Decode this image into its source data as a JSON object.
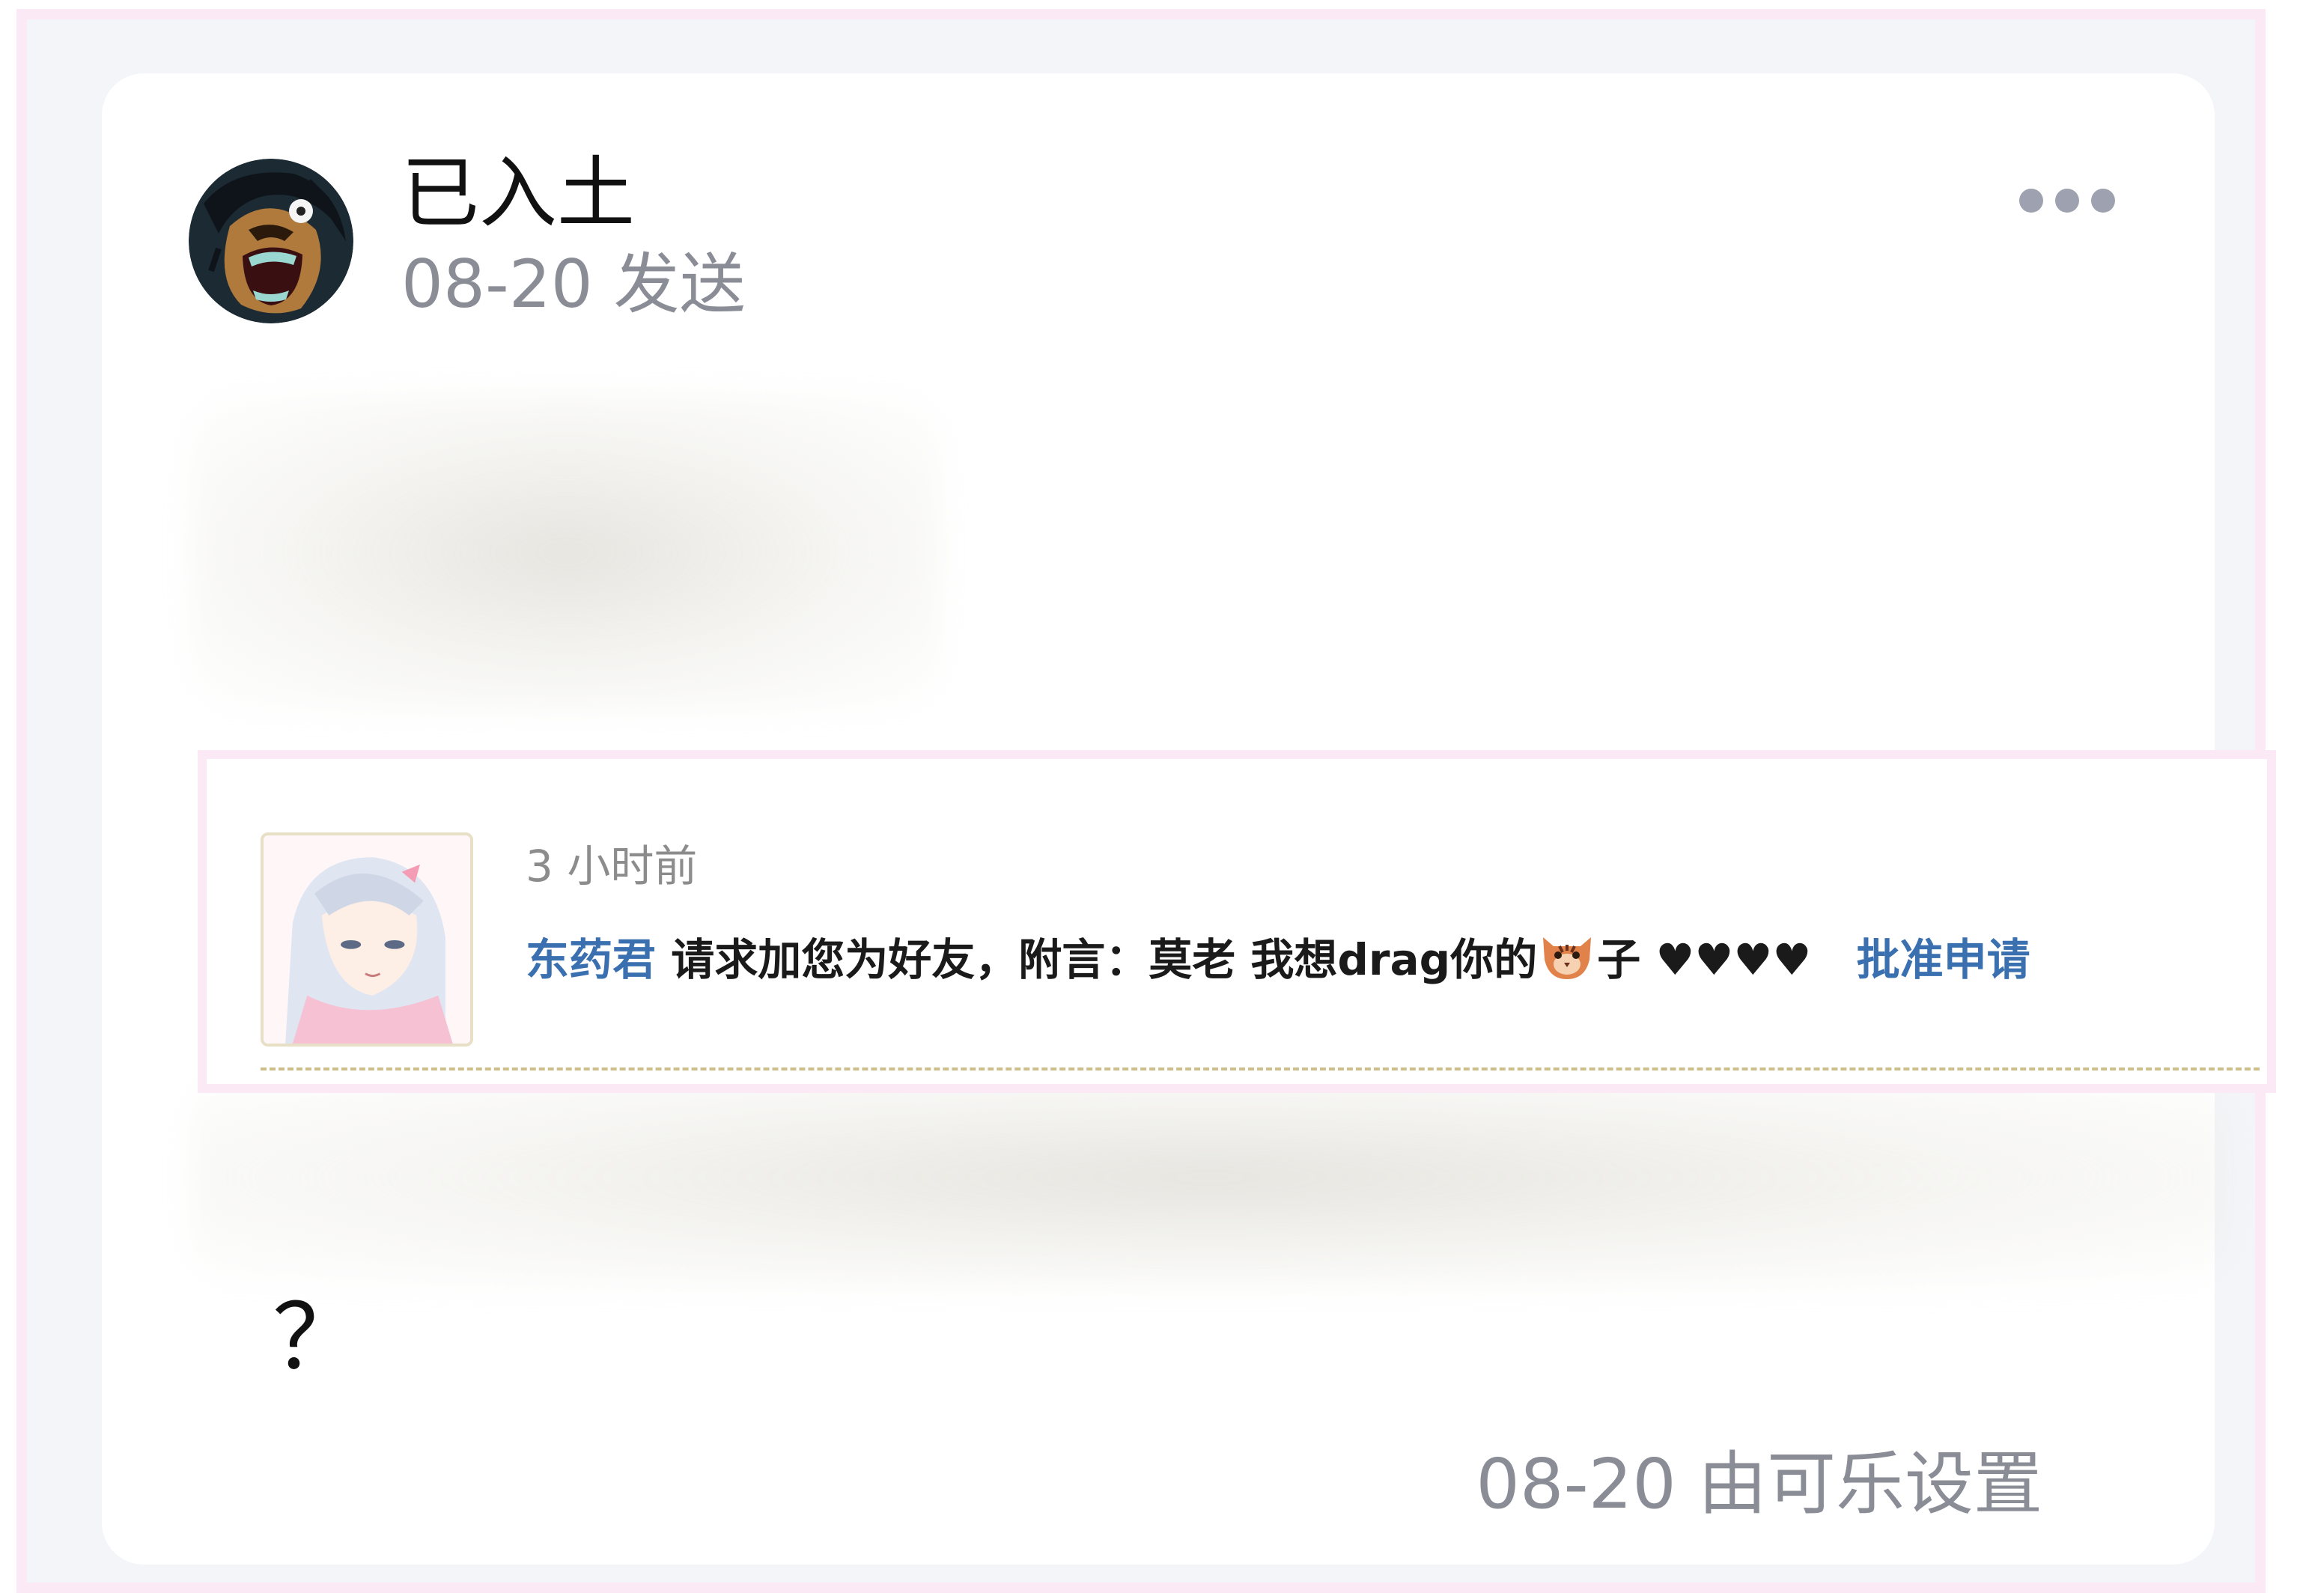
{
  "post": {
    "author": "已入土",
    "sent_time": "08-20 发送",
    "question": "？",
    "footer": "08-20 由可乐设置"
  },
  "notice": {
    "time": "3 小时前",
    "user": "东药君",
    "text_before": "请求加您为好友，附言：莫老 我想drag你的",
    "text_after": "子 ♥♥♥♥",
    "approve": "批准申请"
  },
  "icons": {
    "more": "more-horizontal-icon",
    "emoji": "tiger-face-icon"
  },
  "colors": {
    "frame_background": "#f4f5f9",
    "frame_border": "#fbe9f6",
    "card_background": "#ffffff",
    "muted_text": "#8a8d96",
    "link": "#3a6fb0"
  }
}
